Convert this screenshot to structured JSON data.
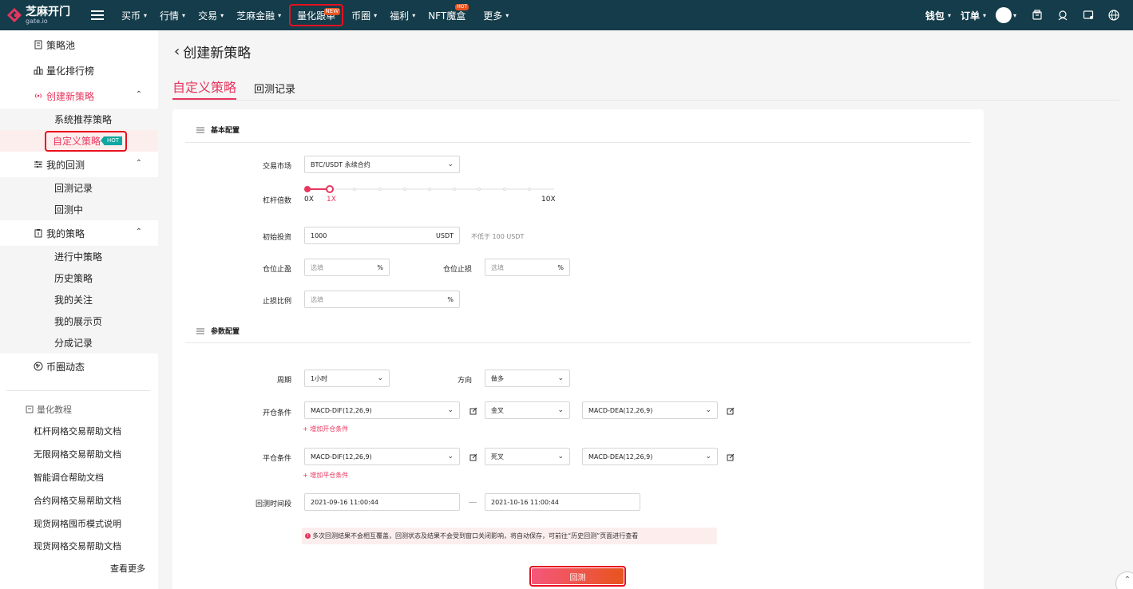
{
  "brand": {
    "name": "芝麻开门",
    "sub": "gate.io"
  },
  "nav": {
    "items": [
      {
        "label": "买币",
        "caret": "▾"
      },
      {
        "label": "行情",
        "caret": "▾"
      },
      {
        "label": "交易",
        "caret": "▾"
      },
      {
        "label": "芝麻金融",
        "caret": "▾"
      },
      {
        "label": "量化跟单",
        "badge": "NEW"
      },
      {
        "label": "币圈",
        "caret": "▾"
      },
      {
        "label": "福利",
        "caret": "▾"
      },
      {
        "label": "NFT魔盒",
        "badge": "HOT"
      },
      {
        "label": "更多",
        "caret": "▾"
      }
    ],
    "right": {
      "wallet": "钱包",
      "orders": "订单"
    }
  },
  "sidebar": {
    "pool": "策略池",
    "ranking": "量化排行榜",
    "create": "创建新策略",
    "create_items": [
      "系统推荐策略",
      "自定义策略"
    ],
    "hot": "HOT",
    "backtest": "我的回测",
    "backtest_items": [
      "回测记录",
      "回测中"
    ],
    "mine": "我的策略",
    "mine_items": [
      "进行中策略",
      "历史策略",
      "我的关注",
      "我的展示页",
      "分成记录"
    ],
    "news": "币圈动态",
    "tutorial_head": "量化教程",
    "tutorials": [
      "杠杆网格交易帮助文档",
      "无限网格交易帮助文档",
      "智能调仓帮助文档",
      "合约网格交易帮助文档",
      "现货网格囤币模式说明",
      "现货网格交易帮助文档"
    ],
    "more": "查看更多"
  },
  "page": {
    "title": "创建新策略",
    "back": "‹"
  },
  "tabs": [
    "自定义策略",
    "回测记录"
  ],
  "basic": {
    "head": "基本配置",
    "market_label": "交易市场",
    "market_value": "BTC/USDT 永续合约",
    "leverage_label": "杠杆倍数",
    "leverage_min": "0X",
    "leverage_cur": "1X",
    "leverage_max": "10X",
    "leverage_level": 0.1,
    "invest_label": "初始投资",
    "invest_value": "1000",
    "invest_unit": "USDT",
    "invest_hint": "不低于 100 USDT",
    "tp_label": "仓位止盈",
    "tp_placeholder": "选填",
    "sl_label": "仓位止损",
    "sl_placeholder": "选填",
    "stop_label": "止损比例",
    "stop_placeholder": "选填",
    "pct": "%"
  },
  "params": {
    "head": "参数配置",
    "period_label": "周期",
    "period_value": "1小时",
    "dir_label": "方向",
    "dir_value": "做多",
    "open_label": "开仓条件",
    "open_ind1": "MACD-DIF(12,26,9)",
    "open_cross": "金叉",
    "open_ind2": "MACD-DEA(12,26,9)",
    "open_add": "+ 增加开仓条件",
    "close_label": "平仓条件",
    "close_ind1": "MACD-DIF(12,26,9)",
    "close_cross": "死叉",
    "close_ind2": "MACD-DEA(12,26,9)",
    "close_add": "+ 增加平仓条件",
    "range_label": "回测时间段",
    "range_start": "2021-09-16 11:00:44",
    "range_end": "2021-10-16 11:00:44",
    "notice": "多次回测结果不会相互覆盖，回测状态及结果不会受到窗口关闭影响，将自动保存，可前往“历史回测”页面进行查看",
    "submit": "回测"
  },
  "colors": {
    "nav_bg": "#143c4a",
    "accent": "#e8365e",
    "hot": "#0fa8a0",
    "badge": "#e8521e"
  }
}
